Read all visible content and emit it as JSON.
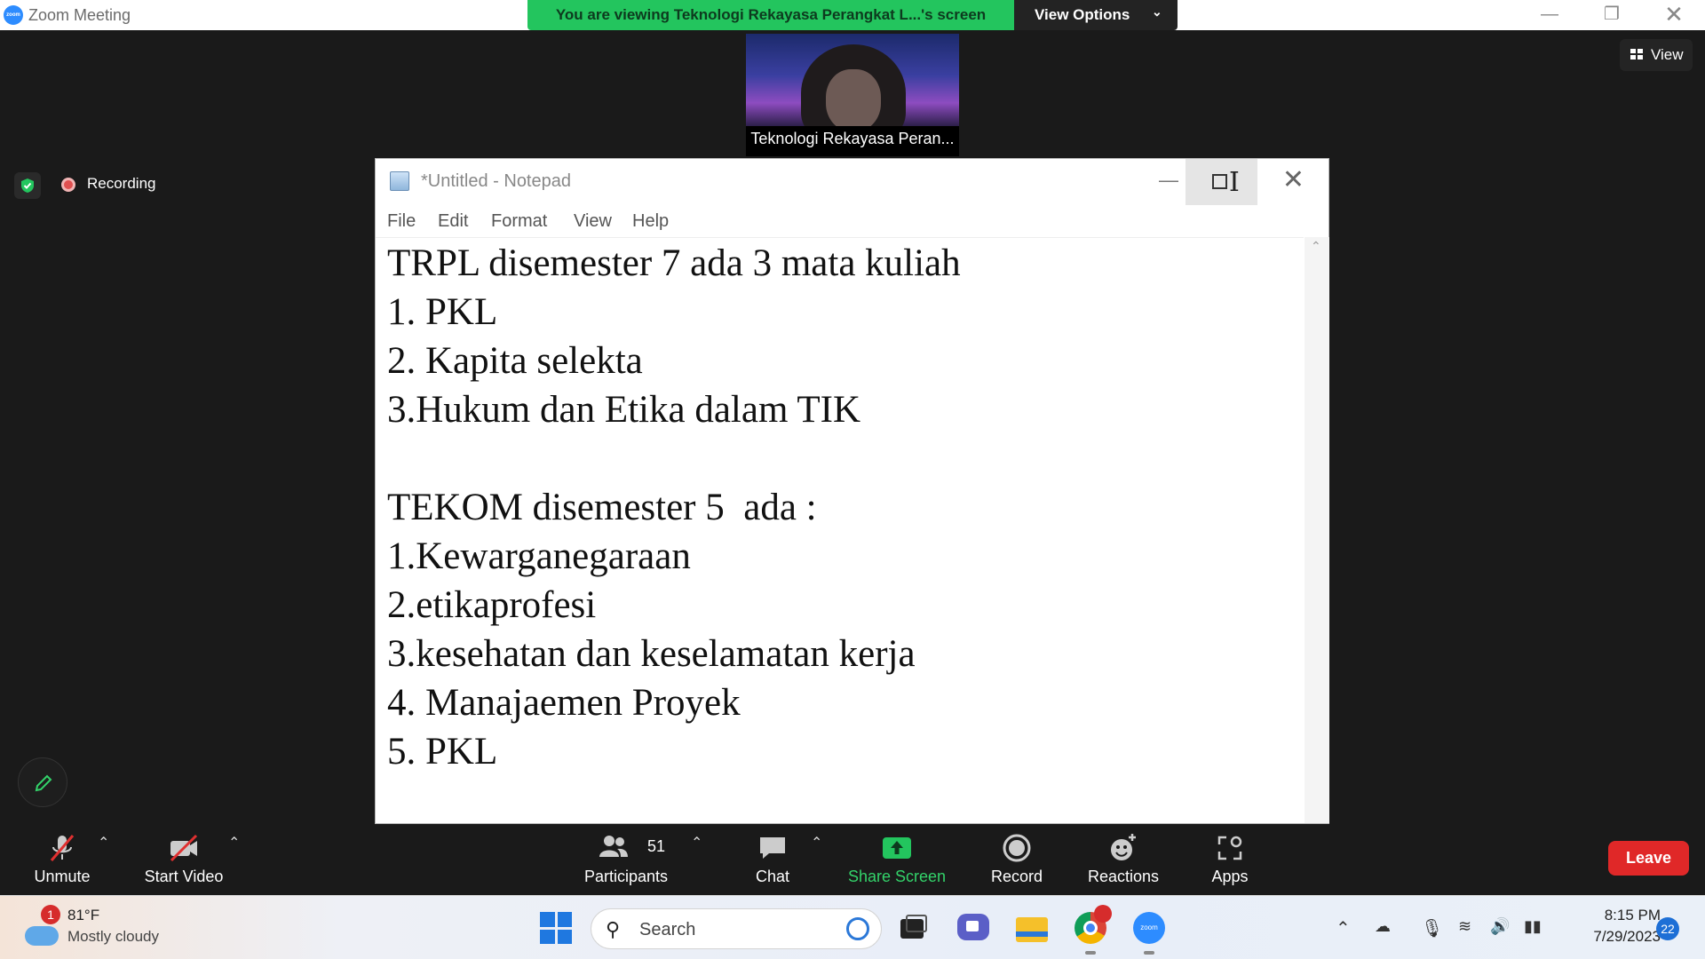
{
  "app": {
    "title": "Zoom Meeting",
    "share_banner": "You are viewing Teknologi Rekayasa Perangkat L...'s screen",
    "view_options_label": "View Options",
    "view_label": "View"
  },
  "participant": {
    "name": "Teknologi Rekayasa Peran..."
  },
  "status": {
    "recording_label": "Recording"
  },
  "notepad": {
    "title": "*Untitled - Notepad",
    "menu": [
      "File",
      "Edit",
      "Format",
      "View",
      "Help"
    ],
    "lines": [
      "TRPL disemester 7 ada 3 mata kuliah",
      "1. PKL",
      "2. Kapita selekta",
      "3.Hukum dan Etika dalam TIK",
      "",
      "TEKOM disemester 5  ada :",
      "1.Kewarganegaraan",
      "2.etikaprofesi",
      "3.kesehatan dan keselamatan kerja",
      "4. Manajaemen Proyek",
      "5. PKL"
    ]
  },
  "toolbar": {
    "unmute": "Unmute",
    "start_video": "Start Video",
    "participants": "Participants",
    "participants_count": "51",
    "chat": "Chat",
    "share_screen": "Share Screen",
    "record": "Record",
    "reactions": "Reactions",
    "apps": "Apps",
    "leave": "Leave"
  },
  "taskbar": {
    "weather_badge": "1",
    "temperature": "81°F",
    "condition": "Mostly cloudy",
    "search_label": "Search",
    "time": "8:15 PM",
    "date": "7/29/2023",
    "notification_count": "22"
  },
  "colors": {
    "zoom_green": "#23c55e",
    "leave_red": "#e02828",
    "share_green": "#33d36a",
    "zoom_blue": "#2d8cff"
  }
}
